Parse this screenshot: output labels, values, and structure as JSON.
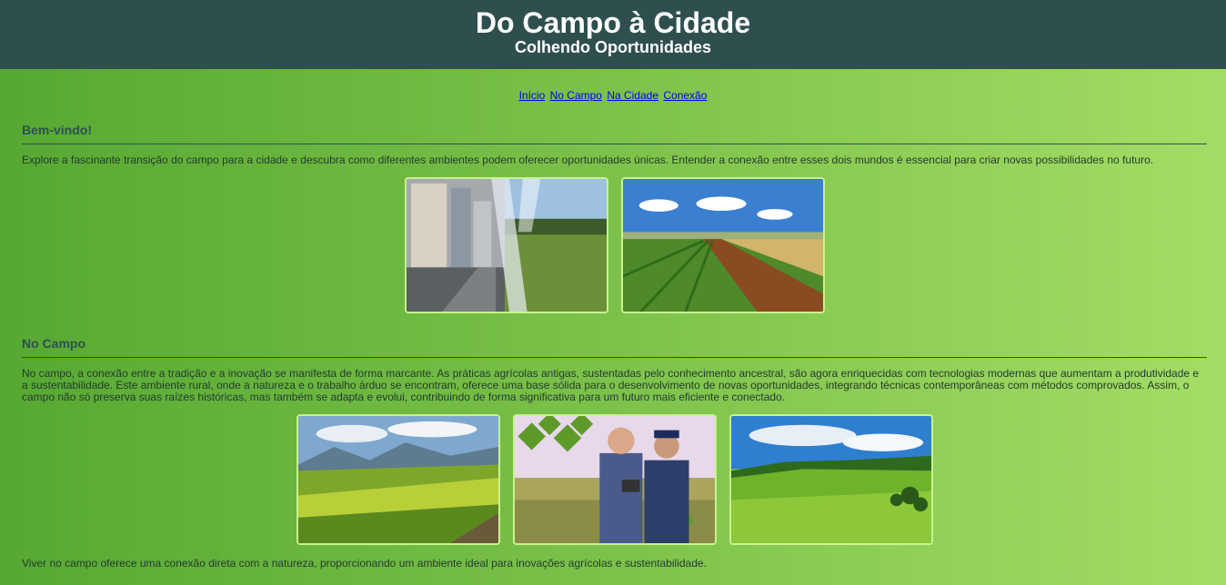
{
  "header": {
    "title": "Do Campo à Cidade",
    "subtitle": "Colhendo Oportunidades"
  },
  "nav": {
    "links": [
      "Início",
      "No Campo",
      "Na Cidade",
      "Conexão"
    ]
  },
  "welcome": {
    "title": "Bem-vindo!",
    "text": "Explore a fascinante transição do campo para a cidade e descubra como diferentes ambientes podem oferecer oportunidades únicas. Entender a conexão entre esses dois mundos é essencial para criar novas possibilidades no futuro.",
    "images": [
      "city-to-country-collage",
      "crop-field-dirt-road"
    ]
  },
  "campo": {
    "title": "No Campo",
    "text": "No campo, a conexão entre a tradição e a inovação se manifesta de forma marcante. As práticas agrícolas antigas, sustentadas pelo conhecimento ancestral, são agora enriquecidas com tecnologias modernas que aumentam a produtividade e a sustentabilidade. Este ambiente rural, onde a natureza e o trabalho árduo se encontram, oferece uma base sólida para o desenvolvimento de novas oportunidades, integrando técnicas contemporâneas com métodos comprovados. Assim, o campo não só preserva suas raízes históricas, mas também se adapta e evolui, contribuindo de forma significativa para um futuro mais eficiente e conectado.",
    "images": [
      "green-fields-mountains",
      "farmers-with-tablet",
      "rolling-green-hills"
    ],
    "footer_text": "Viver no campo oferece uma conexão direta com a natureza, proporcionando um ambiente ideal para inovações agrícolas e sustentabilidade."
  }
}
